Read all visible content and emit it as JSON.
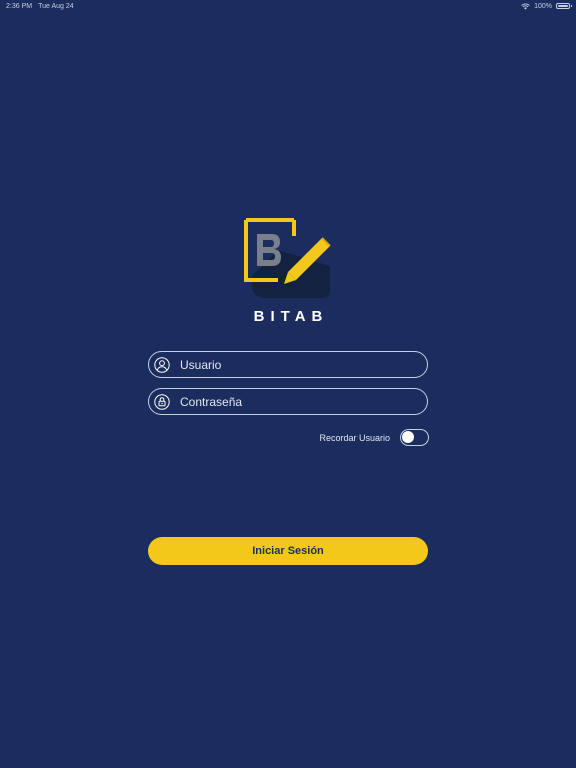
{
  "status_bar": {
    "time": "2:36 PM",
    "date": "Tue Aug 24",
    "battery": "100%"
  },
  "app": {
    "name": "BITAB"
  },
  "form": {
    "username_placeholder": "Usuario",
    "password_placeholder": "Contraseña",
    "remember_label": "Recordar Usuario",
    "remember_enabled": false,
    "submit_label": "Iniciar Sesión"
  },
  "colors": {
    "background": "#1b2d5e",
    "accent": "#f3c81a"
  },
  "icons": {
    "username": "user-circle-icon",
    "password": "lock-circle-icon"
  }
}
